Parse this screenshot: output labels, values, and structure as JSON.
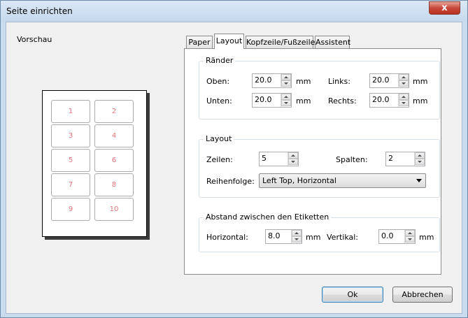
{
  "window": {
    "title": "Seite einrichten",
    "close_glyph": "x"
  },
  "preview": {
    "label": "Vorschau",
    "cells": [
      "1",
      "2",
      "3",
      "4",
      "5",
      "6",
      "7",
      "8",
      "9",
      "10"
    ]
  },
  "tabs": [
    "Paper",
    "Layout",
    "Kopfzeile/Fußzeile",
    "Assistent"
  ],
  "active_tab": "Layout",
  "margins": {
    "title": "Ränder",
    "top_label": "Oben:",
    "top_value": "20.0",
    "bottom_label": "Unten:",
    "bottom_value": "20.0",
    "left_label": "Links:",
    "left_value": "20.0",
    "right_label": "Rechts:",
    "right_value": "20.0",
    "unit": "mm"
  },
  "layout": {
    "title": "Layout",
    "rows_label": "Zeilen:",
    "rows_value": "5",
    "cols_label": "Spalten:",
    "cols_value": "2",
    "order_label": "Reihenfolge:",
    "order_value": "Left Top, Horizontal"
  },
  "spacing": {
    "title": "Abstand zwischen den Etiketten",
    "horizontal_label": "Horizontal:",
    "horizontal_value": "8.0",
    "vertical_label": "Vertikal:",
    "vertical_value": "0.0",
    "unit": "mm"
  },
  "buttons": {
    "ok": "Ok",
    "cancel": "Abbrechen"
  },
  "colors": {
    "label_number": "#e5717c",
    "title_bar": "#c5d9ee",
    "close_button": "#c8483a"
  },
  "icons": [
    "close-icon",
    "spin-up-icon",
    "spin-down-icon",
    "dropdown-arrow-icon"
  ]
}
